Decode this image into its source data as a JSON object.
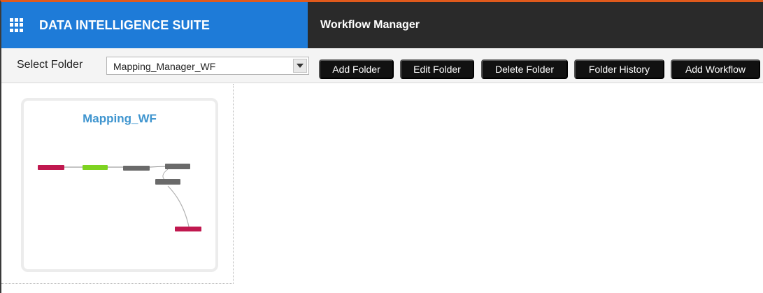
{
  "header": {
    "brand_title": "DATA INTELLIGENCE SUITE",
    "module_title": "Workflow Manager",
    "brand_color": "#1e7bd8",
    "module_bar_color": "#2a2a2a",
    "accent_line_color": "#e05a1c"
  },
  "toolbar": {
    "folder_label": "Select Folder",
    "folder_value": "Mapping_Manager_WF",
    "buttons": {
      "add_folder": "Add Folder",
      "edit_folder": "Edit Folder",
      "delete_folder": "Delete Folder",
      "folder_history": "Folder History",
      "add_workflow": "Add Workflow"
    }
  },
  "workflows": [
    {
      "title": "Mapping_WF",
      "title_color": "#3f95cf",
      "node_colors": {
        "start": "#c0184f",
        "success": "#7ed321",
        "step": "#6a6a6a",
        "end": "#c0184f"
      }
    }
  ]
}
